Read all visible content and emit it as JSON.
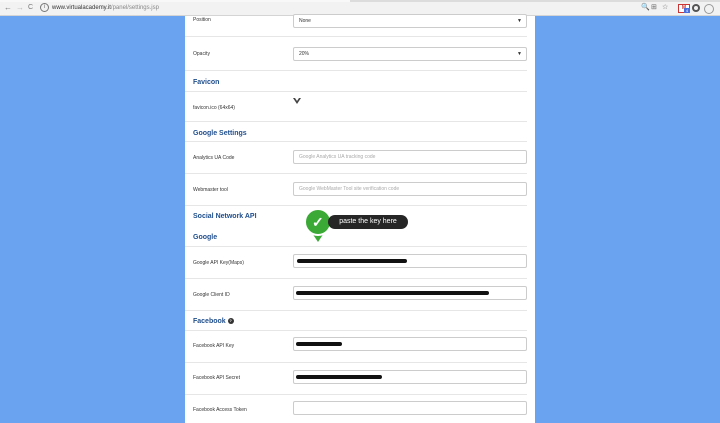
{
  "browser": {
    "url_host": "www.virtualacademy.it",
    "url_path": "/panel/settings.jsp",
    "back_glyph": "←",
    "forward_glyph": "→",
    "reload_glyph": "C",
    "info_glyph": "i",
    "ext_icons": [
      "🔍",
      "⊞",
      "☆"
    ],
    "mail_glyph": "M",
    "mail_badge": "4"
  },
  "form": {
    "position": {
      "label": "Position",
      "value": "None"
    },
    "opacity": {
      "label": "Opacity",
      "value": "20%"
    },
    "select_arrow": "▼",
    "favicon_section": {
      "title": "Favicon",
      "label": "favicon.ico (64x64)"
    },
    "google_settings": {
      "title": "Google Settings",
      "ua_label": "Analytics UA Code",
      "ua_placeholder": "Google Analytics UA tracking code",
      "webmaster_label": "Webmaster tool",
      "webmaster_placeholder": "Google WebMaster Tool site verification code"
    },
    "social": {
      "title": "Social Network API",
      "google_title": "Google",
      "api_key_label": "Google API Key(Maps)",
      "client_id_label": "Google Client ID",
      "facebook_title": "Facebook",
      "help_glyph": "?",
      "fb_api_key_label": "Facebook API Key",
      "fb_api_secret_label": "Facebook API Secret",
      "fb_access_token_label": "Facebook Access Token"
    }
  },
  "callout": {
    "text": "paste the key here",
    "check_glyph": "✓",
    "color": "#3aa935"
  }
}
